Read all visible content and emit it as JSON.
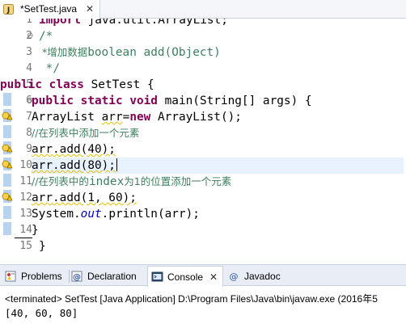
{
  "editor_tab": {
    "title": "*SetTest.java",
    "close_icon": "close-icon",
    "file_icon": "java-file-icon"
  },
  "code": {
    "line_numbers": [
      "1",
      "2",
      "3",
      "4",
      "5",
      "6",
      "7",
      "8",
      "9",
      "10",
      "11",
      "12",
      "13",
      "14",
      "15"
    ],
    "line_1": {
      "kw": "import",
      "rest": " java.util.ArrayList;"
    },
    "line_2": "/*",
    "line_3_cjk": " *增加数据",
    "line_3_rest": "boolean add(Object)",
    "line_4": " */",
    "line_5": {
      "kw1": "public",
      "kw2": "class",
      "rest": " SetTest {"
    },
    "line_6": {
      "kw1": "public",
      "kw2": "static",
      "kw3": "void",
      "rest": " main(String[] args) {"
    },
    "line_7": {
      "a": "ArrayList ",
      "var": "arr",
      "b": "=",
      "kw": "new",
      "c": " ArrayList();"
    },
    "line_8": "//在列表中添加一个元素",
    "line_9": {
      "var": "arr",
      "rest": ".add(40);"
    },
    "line_10": {
      "var": "arr",
      "rest": ".add(80);"
    },
    "line_11_a": "//在列表中的",
    "line_11_b": "index",
    "line_11_c": "为1的位置添加一个元素",
    "line_12": {
      "var": "arr",
      "rest": ".add(1, 60);"
    },
    "line_13": {
      "a": "System.",
      "fld": "out",
      "b": ".println(arr);"
    },
    "line_14": "}",
    "line_15": "}"
  },
  "bottom_panel": {
    "tabs": [
      {
        "label": "Problems",
        "icon": "problems-icon"
      },
      {
        "label": "Declaration",
        "icon": "declaration-icon"
      },
      {
        "label": "Console",
        "icon": "console-icon",
        "active": true
      },
      {
        "label": "Javadoc",
        "icon": "javadoc-icon"
      }
    ],
    "close_icon": "close-icon",
    "status": "<terminated> SetTest [Java Application] D:\\Program Files\\Java\\bin\\javaw.exe (2016年5",
    "output": "[40, 60, 80]"
  },
  "colors": {
    "keyword": "#7f0055",
    "comment": "#3f7f5f",
    "static_field": "#0000c0",
    "line_number": "#787878",
    "warning_squiggle": "#e8c000"
  }
}
